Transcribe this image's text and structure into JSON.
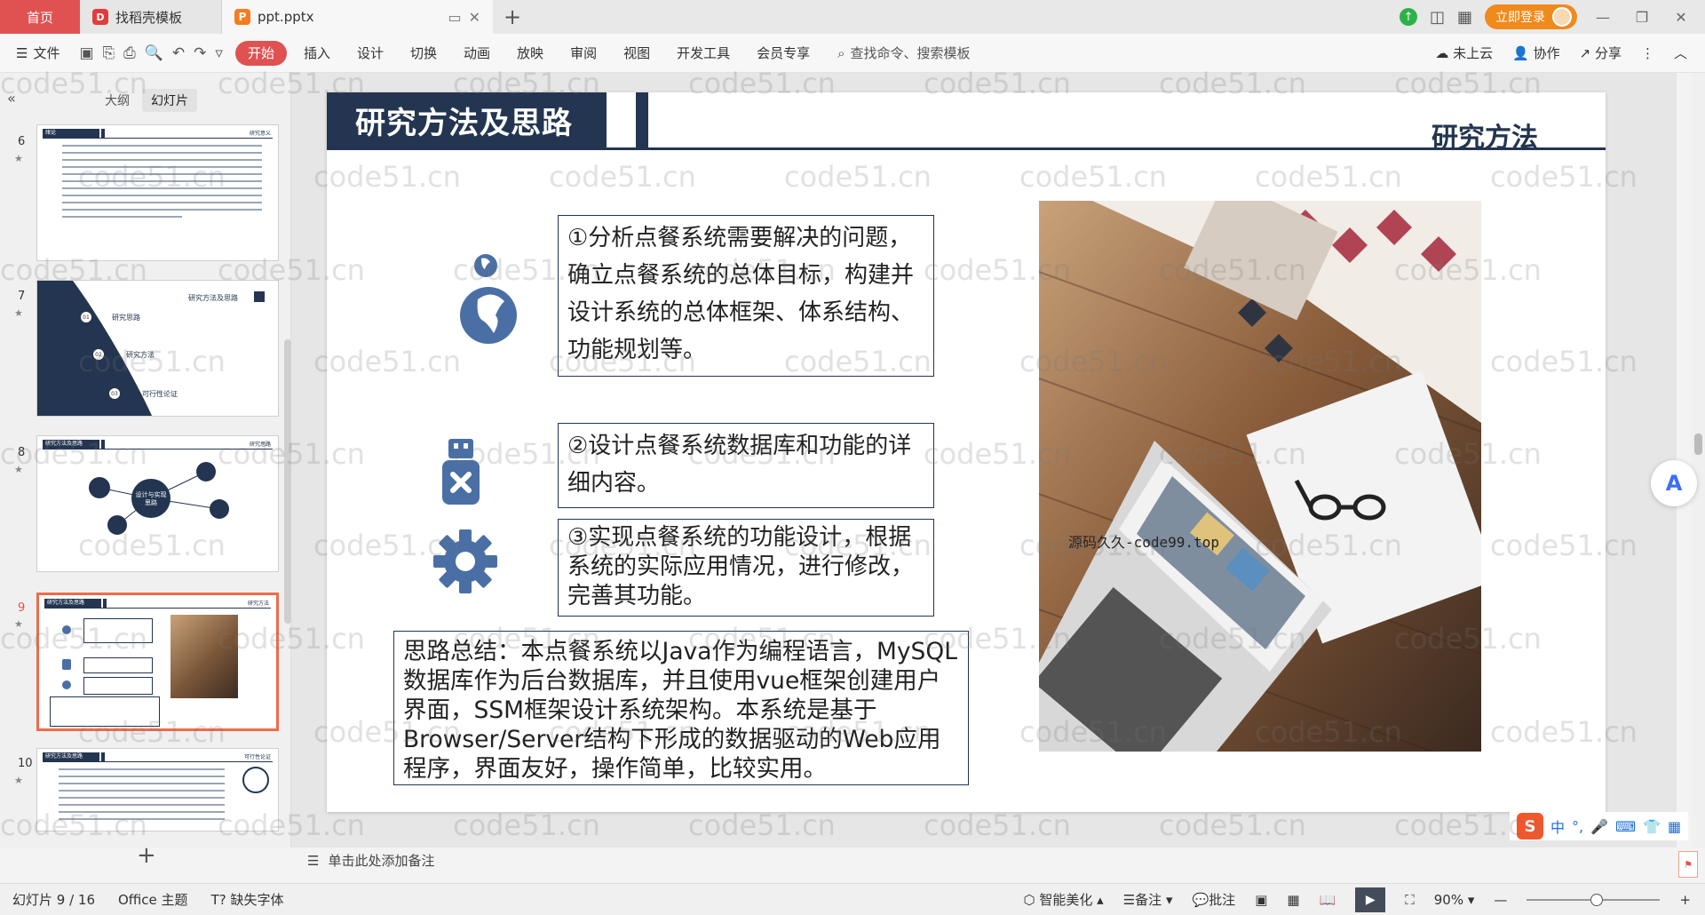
{
  "titlebar": {
    "home_tab": "首页",
    "docer_tab": "找稻壳模板",
    "doc_tab": "ppt.pptx",
    "login_button": "立即登录"
  },
  "menubar": {
    "file": "文件",
    "tabs": [
      "开始",
      "插入",
      "设计",
      "切换",
      "动画",
      "放映",
      "审阅",
      "视图",
      "开发工具",
      "会员专享"
    ],
    "active_tab": "开始",
    "search_placeholder": "查找命令、搜索模板",
    "cloud": "未上云",
    "collab": "协作",
    "share": "分享"
  },
  "leftpanel": {
    "outline_tab": "大纲",
    "slides_tab": "幻灯片",
    "thumbnails": [
      {
        "num": "6",
        "title": "绪论",
        "right": "研究意义"
      },
      {
        "num": "7",
        "right": "研究方法及思路",
        "items": [
          "研究思路",
          "研究方法",
          "可行性论证"
        ],
        "badges": [
          "01",
          "02",
          "03"
        ]
      },
      {
        "num": "8",
        "title": "研究方法及思路",
        "right": "研究思路",
        "center": "设计与实现 思路"
      },
      {
        "num": "9",
        "title": "研究方法及思路",
        "right": "研究方法"
      },
      {
        "num": "10",
        "title": "研究方法及思路",
        "right": "可行性论证"
      }
    ]
  },
  "slide": {
    "title": "研究方法及思路",
    "subtitle": "研究方法",
    "bullets": [
      "①分析点餐系统需要解决的问题，确立点餐系统的总体目标，构建并设计系统的总体框架、体系结构、功能规划等。",
      "②设计点餐系统数据库和功能的详细内容。",
      "③实现点餐系统的功能设计，根据系统的实际应用情况，进行修改，完善其功能。"
    ],
    "summary": "思路总结：本点餐系统以Java作为编程语言，MySQL数据库作为后台数据库，并且使用vue框架创建用户界面，SSM框架设计系统架构。本系统是基于Browser/Server结构下形成的数据驱动的Web应用程序，界面友好，操作简单，比较实用。",
    "overlay": "源码久久-code99.top"
  },
  "notes": {
    "placeholder": "单击此处添加备注"
  },
  "statusbar": {
    "slide_info": "幻灯片 9 / 16",
    "theme": "Office 主题",
    "missing_font": "缺失字体",
    "beautify": "智能美化",
    "notes": "备注",
    "comments": "批注",
    "zoom": "90%"
  },
  "ime": {
    "mode": "中"
  },
  "watermark": "code51.cn",
  "colors": {
    "accent": "#e05252",
    "slide_navy": "#233550",
    "icon_blue": "#4a6fa5"
  }
}
